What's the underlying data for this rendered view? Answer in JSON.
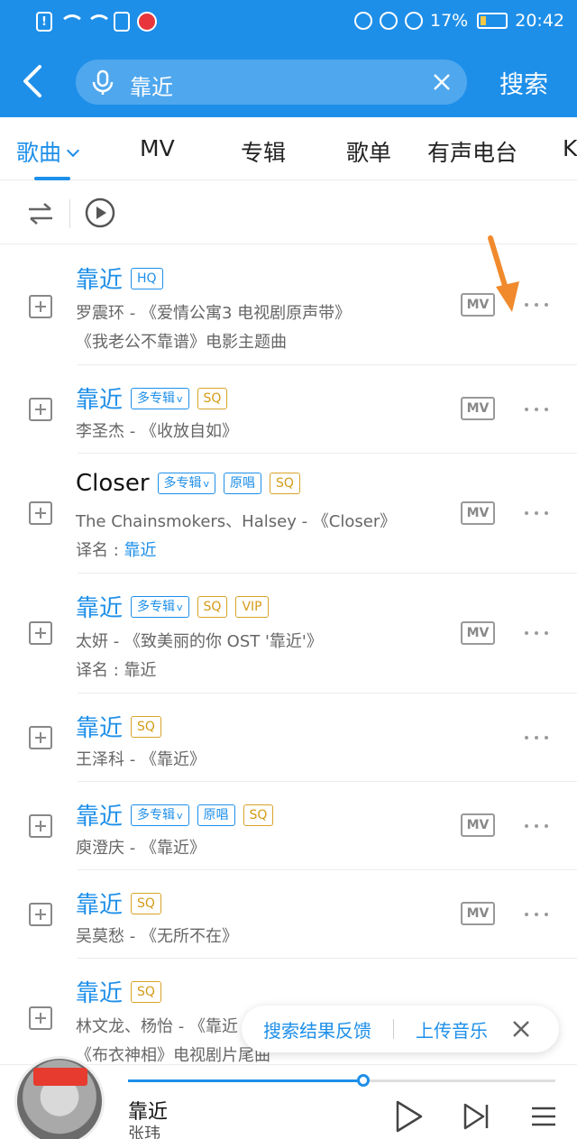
{
  "status_bar": {
    "battery_percent": "17%",
    "time": "20:42"
  },
  "search": {
    "query": "靠近",
    "search_button": "搜索"
  },
  "tabs": [
    {
      "label": "歌曲",
      "active": true
    },
    {
      "label": "MV"
    },
    {
      "label": "专辑"
    },
    {
      "label": "歌单"
    },
    {
      "label": "有声电台"
    },
    {
      "label": "K"
    }
  ],
  "songs": [
    {
      "title": "靠近",
      "tags": [
        "HQ"
      ],
      "sub1": "罗震环 - 《爱情公寓3 电视剧原声带》",
      "sub2": "《我老公不靠谱》电影主题曲",
      "mv": "MV"
    },
    {
      "title": "靠近",
      "tags": [
        "多专辑",
        "SQ"
      ],
      "sub1": "李圣杰 - 《收放自如》",
      "mv": "MV"
    },
    {
      "title": "Closer",
      "tags": [
        "多专辑",
        "原唱",
        "SQ"
      ],
      "sub1": "The Chainsmokers、Halsey - 《Closer》",
      "sub2_prefix": "译名 : ",
      "sub2_hl": "靠近",
      "mv": "MV"
    },
    {
      "title": "靠近",
      "tags": [
        "多专辑",
        "SQ",
        "VIP"
      ],
      "sub1": "太妍 - 《致美丽的你 OST '靠近'》",
      "sub2": "译名 : 靠近",
      "mv": "MV"
    },
    {
      "title": "靠近",
      "tags": [
        "SQ"
      ],
      "sub1": "王泽科 - 《靠近》"
    },
    {
      "title": "靠近",
      "tags": [
        "多专辑",
        "原唱",
        "SQ"
      ],
      "sub1": "庾澄庆 - 《靠近》",
      "mv": "MV"
    },
    {
      "title": "靠近",
      "tags": [
        "SQ"
      ],
      "sub1": "吴莫愁 - 《无所不在》",
      "mv": "MV"
    },
    {
      "title": "靠近",
      "tags": [
        "SQ"
      ],
      "sub1": "林文龙、杨怡 - 《靠近",
      "sub2": "《布衣神相》电视剧片尾曲"
    }
  ],
  "feedback": {
    "left": "搜索结果反馈",
    "right": "上传音乐"
  },
  "player": {
    "title": "靠近",
    "artist": "张玮",
    "progress": 0.55
  },
  "colors": {
    "accent": "#1e8fe9",
    "tag_gold": "#d49b16",
    "arrow": "#f08a2c"
  },
  "icons": [
    "back-arrow-icon",
    "mic-icon",
    "clear-icon",
    "sort-icon",
    "play-all-icon",
    "add-icon",
    "mv-icon",
    "more-icon",
    "close-icon",
    "play-icon",
    "next-icon",
    "playlist-icon"
  ]
}
